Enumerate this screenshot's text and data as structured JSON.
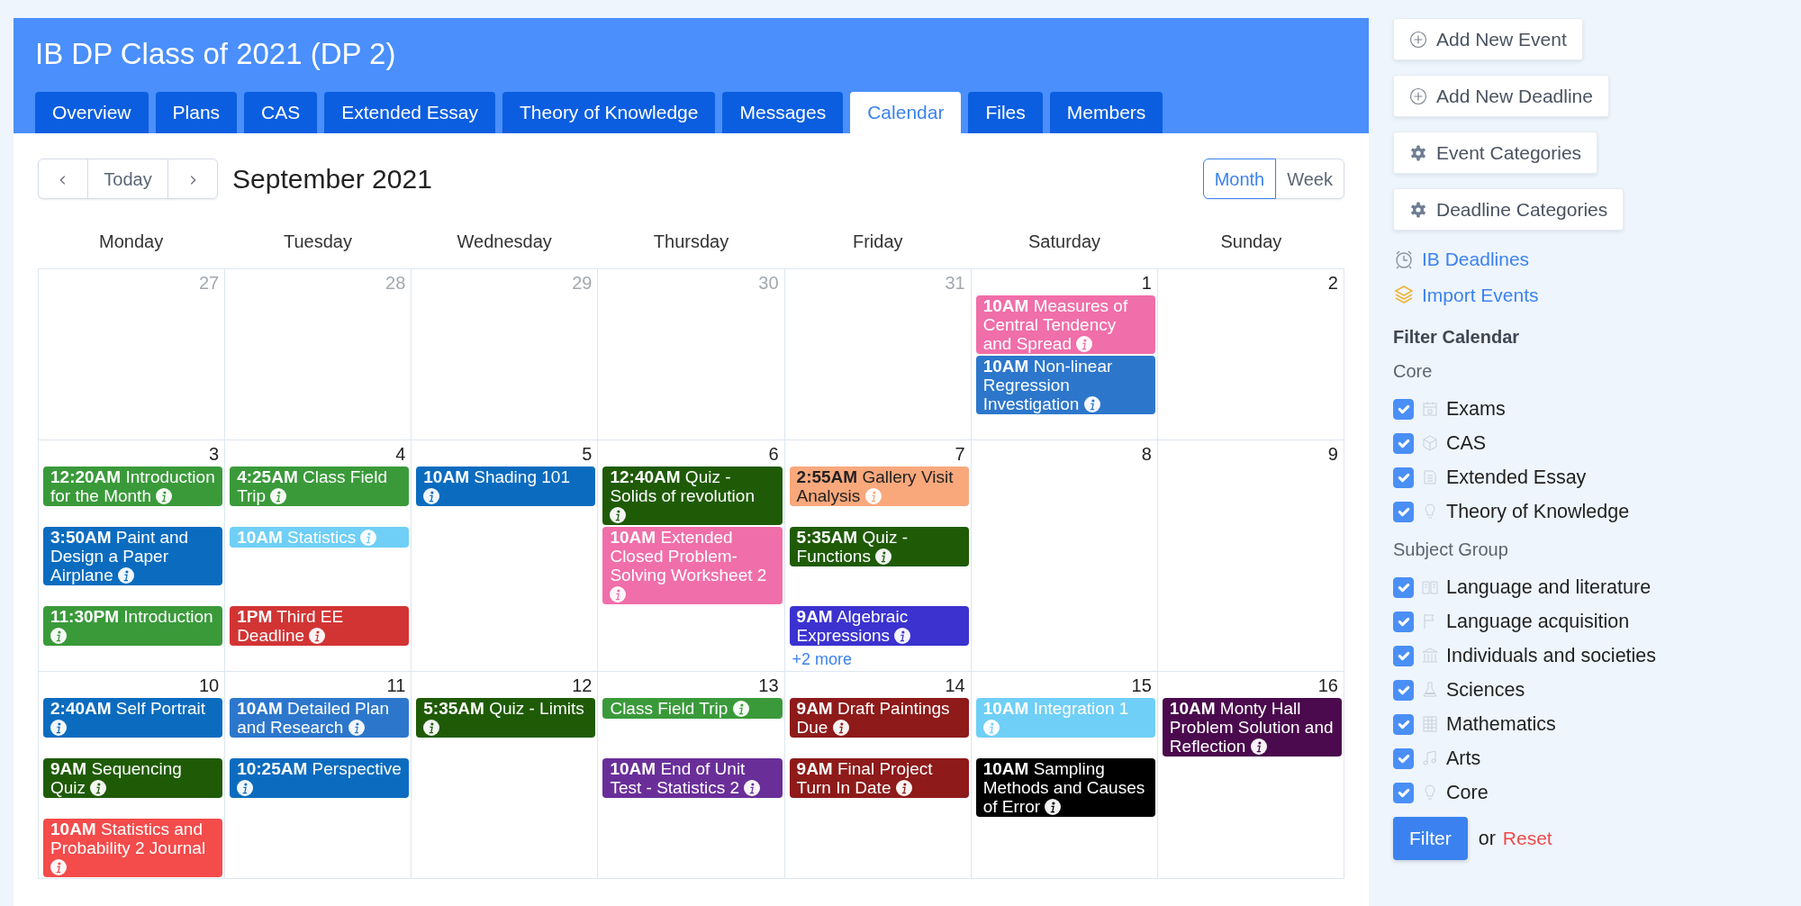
{
  "course": {
    "title": "IB DP Class of 2021 (DP 2)"
  },
  "tabs": [
    {
      "label": "Overview",
      "selected": false
    },
    {
      "label": "Plans",
      "selected": false
    },
    {
      "label": "CAS",
      "selected": false
    },
    {
      "label": "Extended Essay",
      "selected": false
    },
    {
      "label": "Theory of Knowledge",
      "selected": false
    },
    {
      "label": "Messages",
      "selected": false
    },
    {
      "label": "Calendar",
      "selected": true
    },
    {
      "label": "Files",
      "selected": false
    },
    {
      "label": "Members",
      "selected": false
    }
  ],
  "toolbar": {
    "today": "Today",
    "month_title": "September 2021",
    "views": [
      {
        "label": "Month",
        "selected": true
      },
      {
        "label": "Week",
        "selected": false
      }
    ]
  },
  "weekdays": [
    "Monday",
    "Tuesday",
    "Wednesday",
    "Thursday",
    "Friday",
    "Saturday",
    "Sunday"
  ],
  "weeks": [
    {
      "days": [
        {
          "date": "27",
          "other_month": true
        },
        {
          "date": "28",
          "other_month": true
        },
        {
          "date": "29",
          "other_month": true
        },
        {
          "date": "30",
          "other_month": true
        },
        {
          "date": "31",
          "other_month": true
        },
        {
          "date": "1",
          "other_month": false,
          "events": [
            {
              "text": "**10AM** Measures of Central Tendency and Spread",
              "color": "#f06ea9",
              "dark_text": false
            },
            {
              "text": "**10AM** Non-linear Regression Investigation",
              "color": "#2c77cc",
              "dark_text": false
            }
          ]
        },
        {
          "date": "2",
          "other_month": false
        }
      ]
    },
    {
      "days": [
        {
          "date": "3",
          "other_month": false,
          "events": [
            {
              "text": "**12:20AM** Introduction for the Month",
              "color": "#3a9a3a",
              "dark_text": false
            },
            {
              "text": "**3:50AM** Paint and Design a Paper Airplane",
              "color": "#0b6cbf",
              "dark_text": false
            },
            {
              "text": "**11:30PM** Introduction",
              "color": "#3a9a3a",
              "dark_text": false
            }
          ]
        },
        {
          "date": "4",
          "other_month": false,
          "events": [
            {
              "text": "**4:25AM** Class Field Trip",
              "color": "#3a9a3a",
              "dark_text": false
            },
            {
              "text": "**10AM** Statistics",
              "color": "#6fcff6",
              "dark_text": false
            },
            {
              "text": "**1PM** Third EE Deadline",
              "color": "#d23434",
              "dark_text": false
            }
          ]
        },
        {
          "date": "5",
          "other_month": false,
          "events": [
            {
              "text": "**10AM** Shading 101",
              "color": "#0b6cbf",
              "dark_text": false
            }
          ]
        },
        {
          "date": "6",
          "other_month": false,
          "events": [
            {
              "text": "**12:40AM** Quiz - Solids of revolution",
              "color": "#1f5b07",
              "dark_text": false
            },
            {
              "text": "**10AM** Extended Closed Problem-Solving Worksheet 2",
              "color": "#f06ea9",
              "dark_text": false
            }
          ]
        },
        {
          "date": "7",
          "other_month": false,
          "events": [
            {
              "text": "**2:55AM** Gallery Visit Analysis",
              "color": "#f9a87c",
              "dark_text": true
            },
            {
              "text": "**5:35AM** Quiz - Functions",
              "color": "#1f5b07",
              "dark_text": false
            },
            {
              "text": "**9AM** Algebraic Expressions",
              "color": "#3b32cf",
              "dark_text": false
            }
          ],
          "more": "+2 more"
        },
        {
          "date": "8",
          "other_month": false
        },
        {
          "date": "9",
          "other_month": false
        }
      ]
    },
    {
      "days": [
        {
          "date": "10",
          "other_month": false,
          "events": [
            {
              "text": "**2:40AM** Self Portrait",
              "color": "#0b6cbf",
              "dark_text": false
            },
            {
              "text": "**9AM** Sequencing Quiz",
              "color": "#1f5b07",
              "dark_text": false
            },
            {
              "text": "**10AM** Statistics and Probability 2 Journal",
              "color": "#f44b4b",
              "dark_text": false
            }
          ]
        },
        {
          "date": "11",
          "other_month": false,
          "events": [
            {
              "text": "**10AM** Detailed Plan and Research",
              "color": "#2c77cc",
              "dark_text": false
            },
            {
              "text": "**10:25AM** Perspective",
              "color": "#0b6cbf",
              "dark_text": false
            }
          ]
        },
        {
          "date": "12",
          "other_month": false,
          "events": [
            {
              "text": "**5:35AM** Quiz - Limits",
              "color": "#1f5b07",
              "dark_text": false
            }
          ]
        },
        {
          "date": "13",
          "other_month": false,
          "events": [
            {
              "text": "Class Field Trip",
              "color": "#3a9a3a",
              "dark_text": false
            },
            {
              "text": "**10AM** End of Unit Test - Statistics 2",
              "color": "#6a2e99",
              "dark_text": false
            }
          ]
        },
        {
          "date": "14",
          "other_month": false,
          "events": [
            {
              "text": "**9AM** Draft Paintings Due",
              "color": "#8e1a1a",
              "dark_text": false
            },
            {
              "text": "**9AM** Final Project Turn In Date",
              "color": "#8e1a1a",
              "dark_text": false
            }
          ]
        },
        {
          "date": "15",
          "other_month": false,
          "events": [
            {
              "text": "**10AM** Integration 1",
              "color": "#6fcff6",
              "dark_text": false
            },
            {
              "text": "**10AM** Sampling Methods and Causes of Error",
              "color": "#000000",
              "dark_text": false
            }
          ]
        },
        {
          "date": "16",
          "other_month": false,
          "events": [
            {
              "text": "**10AM** Monty Hall Problem Solution and Reflection",
              "color": "#4a0a4d",
              "dark_text": false
            }
          ]
        }
      ]
    }
  ],
  "sidebar": {
    "actions": [
      {
        "label": "Add New Event",
        "kind": "add"
      },
      {
        "label": "Add New Deadline",
        "kind": "add"
      },
      {
        "label": "Event Categories",
        "kind": "settings"
      },
      {
        "label": "Deadline Categories",
        "kind": "settings"
      }
    ],
    "links": [
      {
        "label": "IB Deadlines"
      },
      {
        "label": "Import Events"
      }
    ],
    "filter": {
      "title": "Filter Calendar",
      "groups": [
        {
          "name": "Core",
          "items": [
            {
              "label": "Exams",
              "checked": true
            },
            {
              "label": "CAS",
              "checked": true
            },
            {
              "label": "Extended Essay",
              "checked": true
            },
            {
              "label": "Theory of Knowledge",
              "checked": true
            }
          ]
        },
        {
          "name": "Subject Group",
          "items": [
            {
              "label": "Language and literature",
              "checked": true
            },
            {
              "label": "Language acquisition",
              "checked": true
            },
            {
              "label": "Individuals and societies",
              "checked": true
            },
            {
              "label": "Sciences",
              "checked": true
            },
            {
              "label": "Mathematics",
              "checked": true
            },
            {
              "label": "Arts",
              "checked": true
            },
            {
              "label": "Core",
              "checked": true
            }
          ]
        }
      ],
      "apply": "Filter",
      "or": "or",
      "reset": "Reset"
    }
  }
}
